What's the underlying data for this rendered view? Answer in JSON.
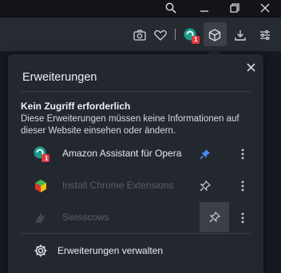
{
  "panel": {
    "title": "Erweiterungen",
    "section_heading": "Kein Zugriff erforderlich",
    "section_description": "Diese Erweiterungen müssen keine Informationen auf dieser Website einsehen oder ändern.",
    "extensions": [
      {
        "name": "Amazon Assistant für Opera",
        "pinned": true,
        "enabled": true
      },
      {
        "name": "Install Chrome Extensions",
        "pinned": false,
        "enabled": false
      },
      {
        "name": "Swisscows",
        "pinned": false,
        "enabled": false
      }
    ],
    "manage_label": "Erweiterungen verwalten"
  },
  "toolbar": {
    "amazon_badge": "1",
    "icons": [
      "camera-icon",
      "heart-icon",
      "amazon-assistant-icon",
      "extensions-cube-icon",
      "download-icon",
      "settings-sliders-icon"
    ]
  },
  "extension_badge": "1",
  "colors": {
    "pin_active": "#4c8bf5",
    "badge": "#e0383e",
    "panel_bg": "#23272e"
  }
}
